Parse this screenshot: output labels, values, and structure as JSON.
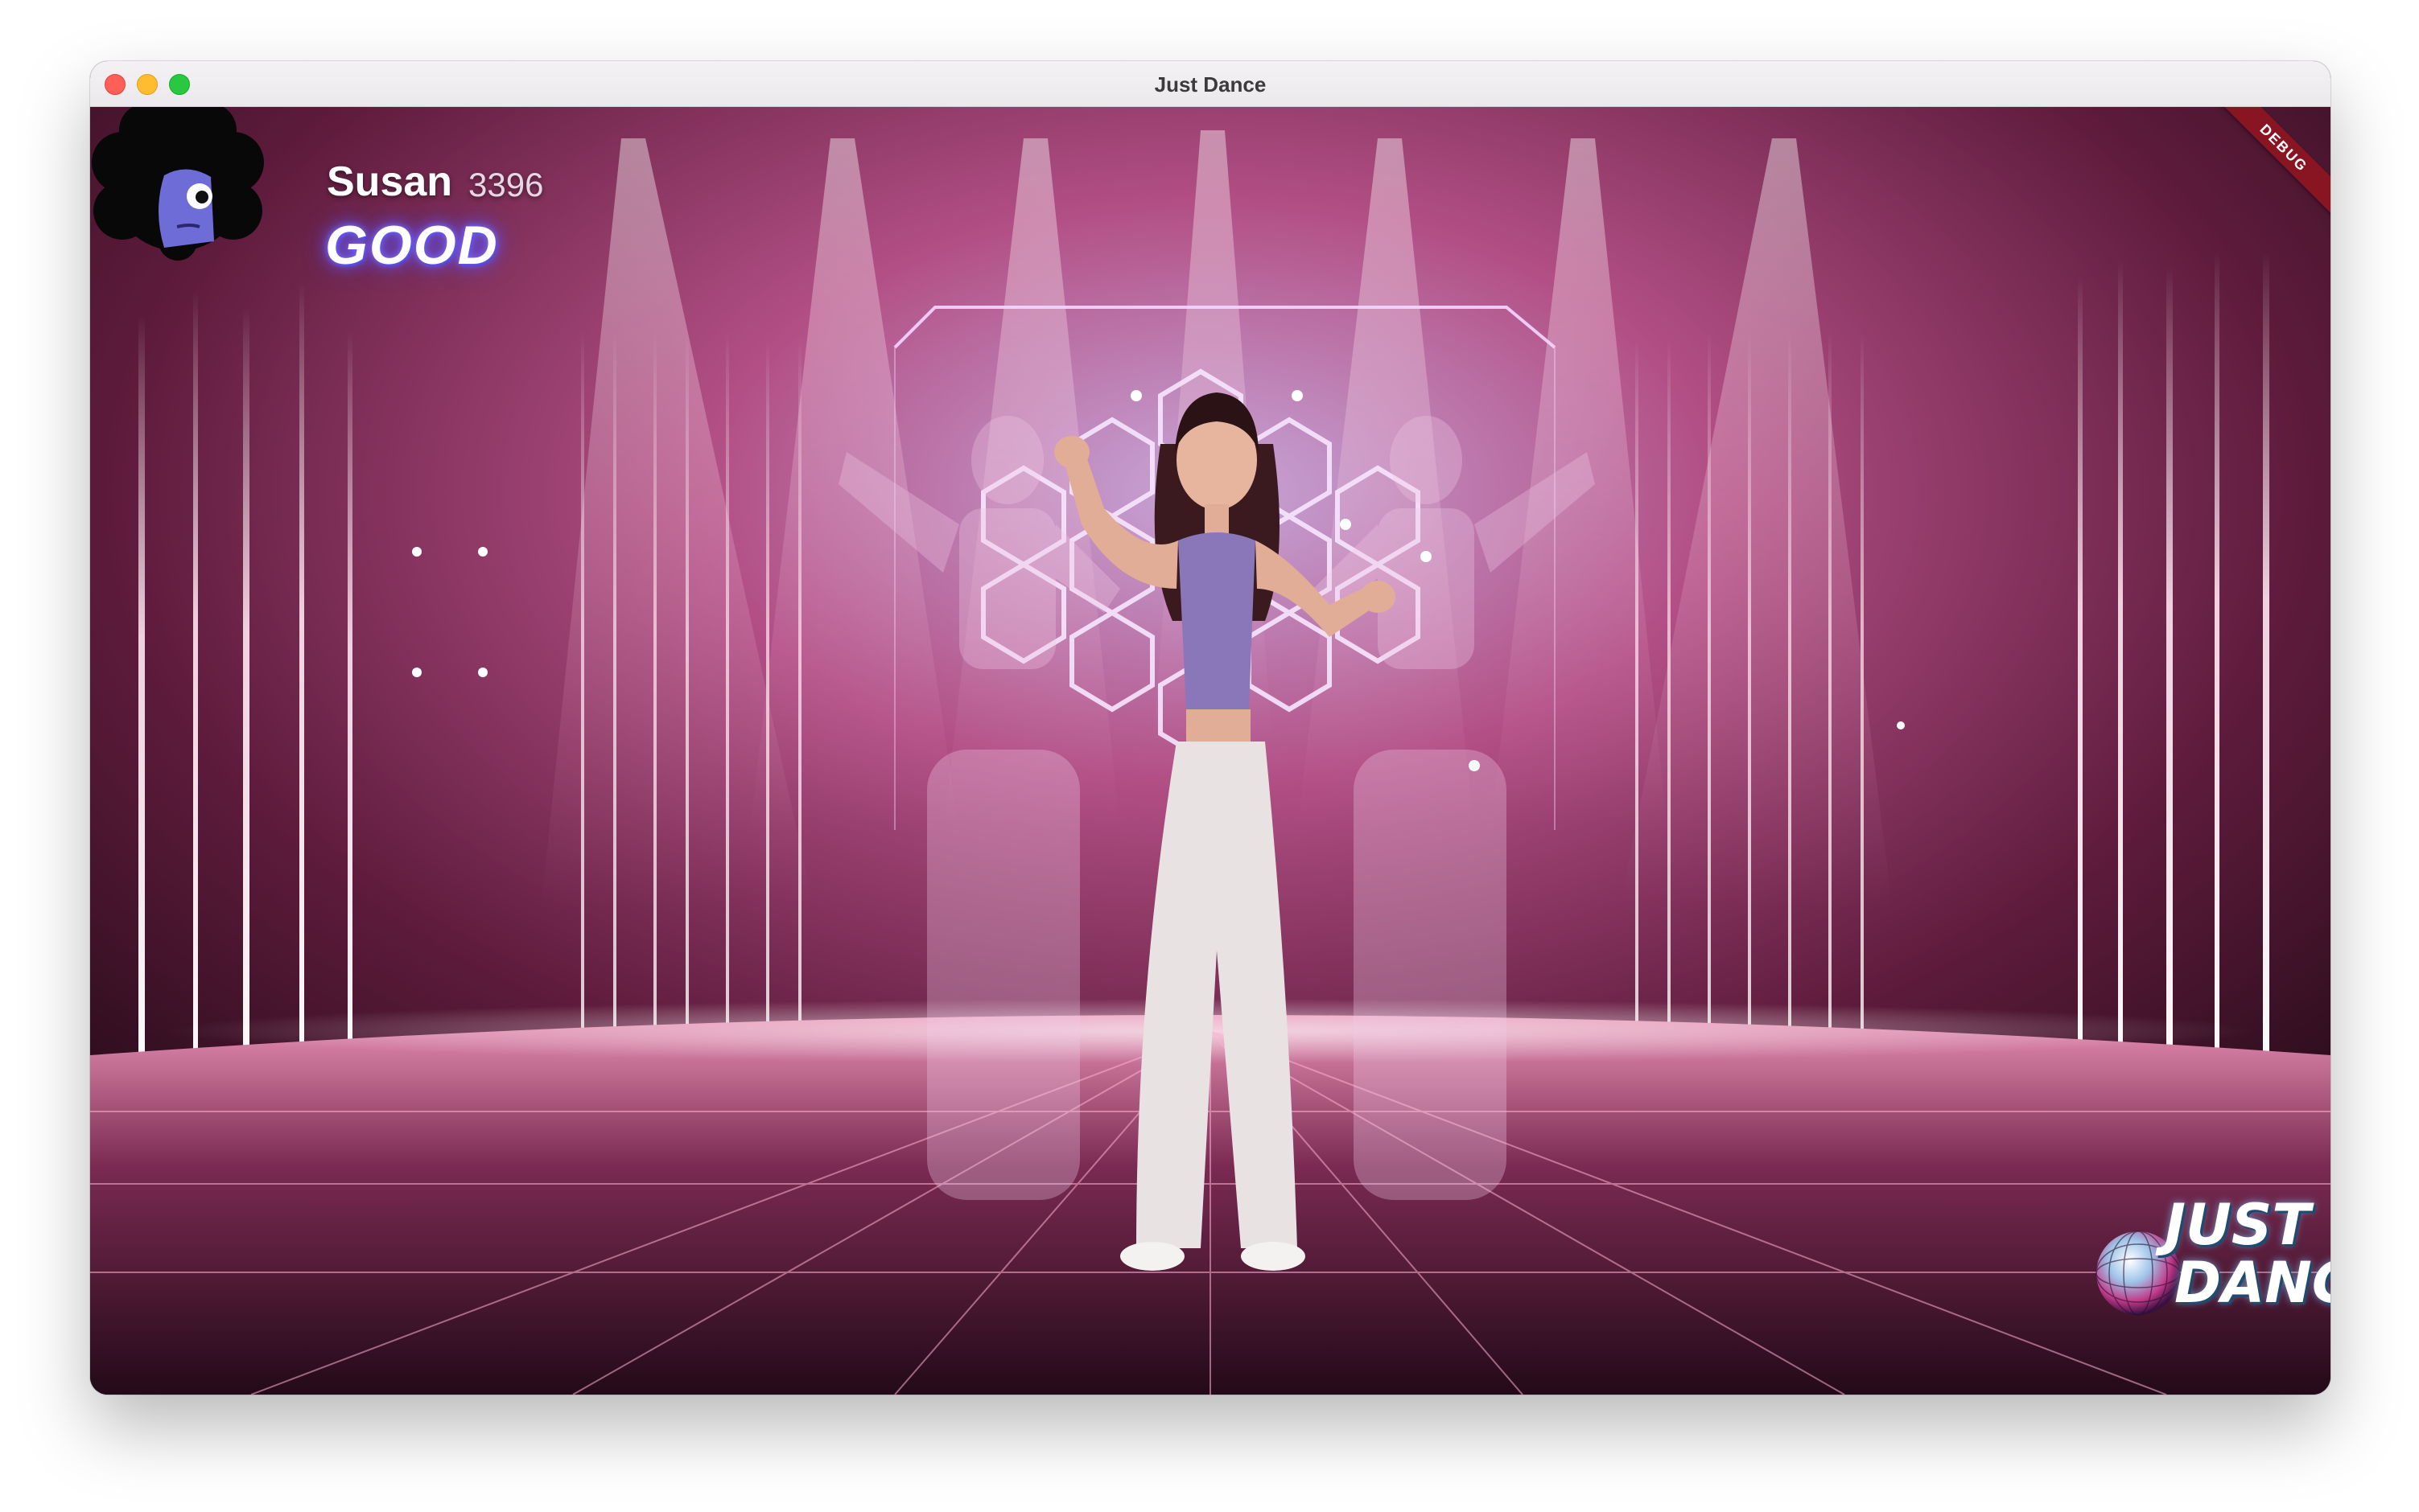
{
  "window": {
    "title": "Just Dance"
  },
  "player": {
    "name": "Susan",
    "score": "3396",
    "rating": "GOOD"
  },
  "badge": {
    "debug": "DEBUG"
  },
  "logo": {
    "line1": "JUST",
    "line2": "DANCE"
  },
  "icons": [
    "close-icon",
    "minimize-icon",
    "maximize-icon",
    "avatar-icon",
    "disco-ball-icon"
  ],
  "colors": {
    "stage": "#e0567f",
    "rating_glow": "#6a5cff",
    "debug": "#8a1522"
  }
}
